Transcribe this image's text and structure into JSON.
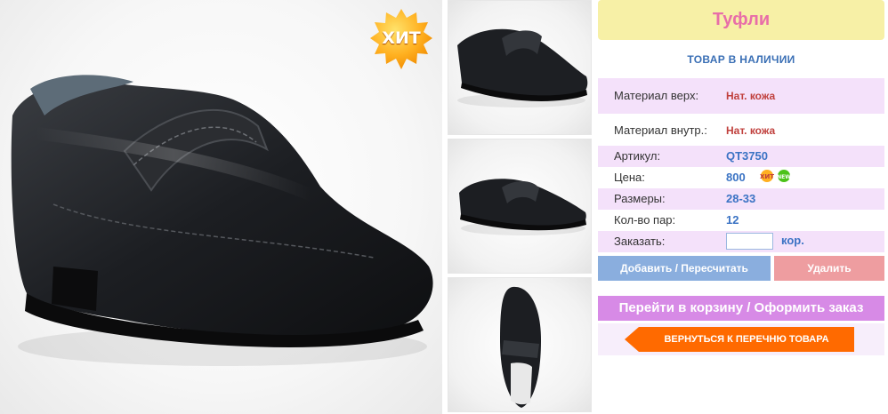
{
  "product": {
    "title": "Туфли",
    "stock_status": "ТОВАР В НАЛИЧИИ",
    "hit_badge": "ХИТ",
    "icons": {
      "hit_badge_icon": "hit-star-badge",
      "new_badge_icon": "new-badge"
    }
  },
  "attributes": {
    "material_top": {
      "label": "Материал верх:",
      "value": "Нат. кожа"
    },
    "material_inner": {
      "label": "Материал внутр.:",
      "value": "Нат. кожа"
    },
    "article": {
      "label": "Артикул:",
      "value": "QT3750"
    },
    "price": {
      "label": "Цена:",
      "value": "800"
    },
    "sizes": {
      "label": "Размеры:",
      "value": "28-33"
    },
    "pairs": {
      "label": "Кол-во пар:",
      "value": "12"
    },
    "order": {
      "label": "Заказать:",
      "value": "",
      "unit": "кор."
    }
  },
  "actions": {
    "add_recalc": "Добавить / Пересчитать",
    "delete": "Удалить",
    "go_to_cart": "Перейти в корзину / Оформить заказ",
    "back_to_list": "ВЕРНУТЬСЯ К ПЕРЕЧНЮ ТОВАРА"
  },
  "colors": {
    "title_bg": "#f7f0a6",
    "title_text": "#e86ea8",
    "link_blue": "#3a6fb5",
    "add_button": "#8aaede",
    "delete_button": "#ee9da0",
    "cart_button": "#d78ae6",
    "back_button": "#ff6a00"
  }
}
